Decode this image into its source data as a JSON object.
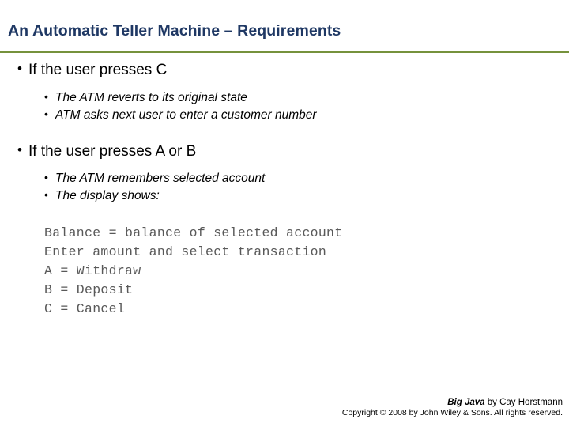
{
  "slide": {
    "title": "An Automatic Teller Machine – Requirements",
    "accent_color": "#76923C",
    "title_color": "#1F3864",
    "bullets": [
      {
        "level1": "If the user presses C",
        "marker1": "•",
        "sub": [
          {
            "marker": "•",
            "text": "The ATM reverts to its original state"
          },
          {
            "marker": "•",
            "text": "ATM asks next user to enter a customer number"
          }
        ]
      },
      {
        "level1": "If the user presses A or B",
        "marker1": "•",
        "sub": [
          {
            "marker": "•",
            "text": "The ATM remembers selected account"
          },
          {
            "marker": "•",
            "text": "The display shows:"
          }
        ]
      }
    ],
    "code_lines": [
      "Balance = balance of selected account",
      "Enter amount and select transaction",
      "A = Withdraw",
      "B = Deposit",
      "C = Cancel"
    ],
    "footer": {
      "book": "Big Java",
      "author": " by Cay Horstmann",
      "copyright": "Copyright © 2008 by John Wiley & Sons.  All rights reserved."
    }
  }
}
